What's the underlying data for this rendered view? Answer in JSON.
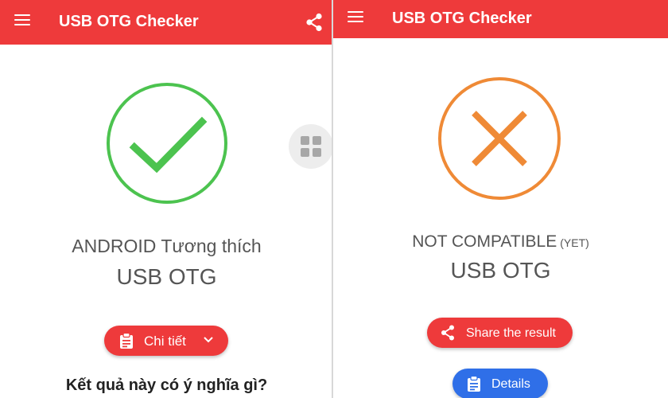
{
  "app": {
    "title": "USB OTG Checker"
  },
  "left_screen": {
    "status_icon": "check-icon",
    "status_color": "#4cc34f",
    "result_line1": "ANDROID Tương thích",
    "result_line2": "USB OTG",
    "details_button_label": "Chi tiết",
    "question_heading": "Kết quả này có ý nghĩa gì?"
  },
  "right_screen": {
    "status_icon": "cross-icon",
    "status_color": "#ef8a36",
    "result_line1": "NOT COMPATIBLE",
    "result_suffix": "(YET)",
    "result_line2": "USB OTG",
    "share_button_label": "Share the result",
    "details_button_label": "Details"
  },
  "colors": {
    "appbar": "#ee3a3b",
    "primary_button": "#ee3a3b",
    "details_button_blue": "#2f6fe8"
  }
}
